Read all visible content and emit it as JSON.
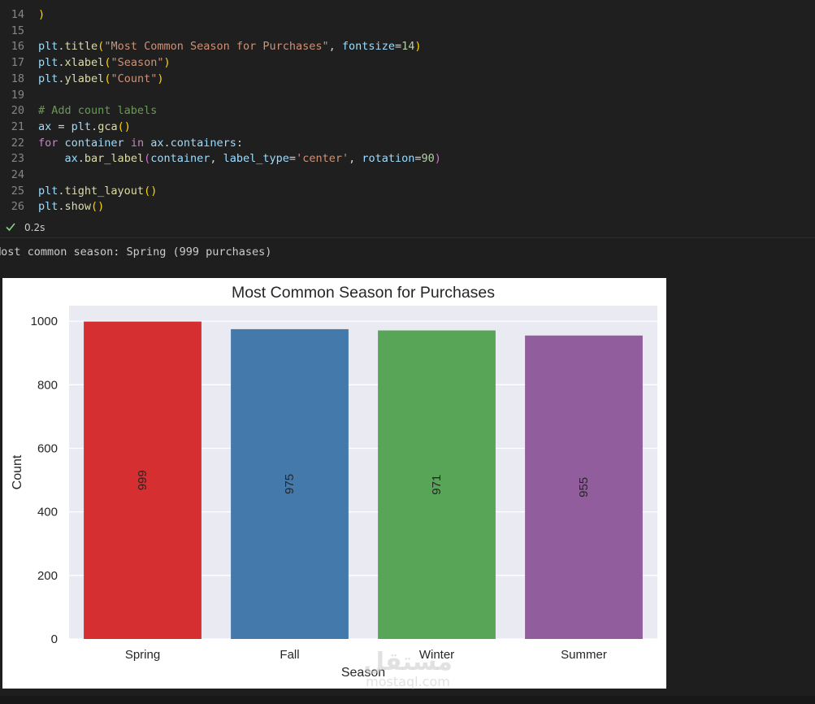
{
  "code_lines": [
    {
      "n": "14",
      "tokens": [
        {
          "t": ")",
          "c": "t-paren"
        }
      ]
    },
    {
      "n": "15",
      "tokens": []
    },
    {
      "n": "16",
      "tokens": [
        {
          "t": "plt",
          "c": "t-var"
        },
        {
          "t": ".",
          "c": ""
        },
        {
          "t": "title",
          "c": "t-fn"
        },
        {
          "t": "(",
          "c": "t-paren"
        },
        {
          "t": "\"Most Common Season for Purchases\"",
          "c": "t-str"
        },
        {
          "t": ", ",
          "c": ""
        },
        {
          "t": "fontsize",
          "c": "t-var"
        },
        {
          "t": "=",
          "c": ""
        },
        {
          "t": "14",
          "c": "t-num"
        },
        {
          "t": ")",
          "c": "t-paren"
        }
      ]
    },
    {
      "n": "17",
      "tokens": [
        {
          "t": "plt",
          "c": "t-var"
        },
        {
          "t": ".",
          "c": ""
        },
        {
          "t": "xlabel",
          "c": "t-fn"
        },
        {
          "t": "(",
          "c": "t-paren"
        },
        {
          "t": "\"Season\"",
          "c": "t-str"
        },
        {
          "t": ")",
          "c": "t-paren"
        }
      ]
    },
    {
      "n": "18",
      "tokens": [
        {
          "t": "plt",
          "c": "t-var"
        },
        {
          "t": ".",
          "c": ""
        },
        {
          "t": "ylabel",
          "c": "t-fn"
        },
        {
          "t": "(",
          "c": "t-paren"
        },
        {
          "t": "\"Count\"",
          "c": "t-str"
        },
        {
          "t": ")",
          "c": "t-paren"
        }
      ]
    },
    {
      "n": "19",
      "tokens": []
    },
    {
      "n": "20",
      "tokens": [
        {
          "t": "# Add count labels",
          "c": "t-com"
        }
      ]
    },
    {
      "n": "21",
      "tokens": [
        {
          "t": "ax",
          "c": "t-var"
        },
        {
          "t": " = ",
          "c": ""
        },
        {
          "t": "plt",
          "c": "t-var"
        },
        {
          "t": ".",
          "c": ""
        },
        {
          "t": "gca",
          "c": "t-fn"
        },
        {
          "t": "()",
          "c": "t-paren"
        }
      ]
    },
    {
      "n": "22",
      "tokens": [
        {
          "t": "for",
          "c": "t-kw"
        },
        {
          "t": " ",
          "c": ""
        },
        {
          "t": "container",
          "c": "t-var"
        },
        {
          "t": " ",
          "c": ""
        },
        {
          "t": "in",
          "c": "t-kw"
        },
        {
          "t": " ",
          "c": ""
        },
        {
          "t": "ax",
          "c": "t-var"
        },
        {
          "t": ".",
          "c": ""
        },
        {
          "t": "containers",
          "c": "t-var"
        },
        {
          "t": ":",
          "c": ""
        }
      ]
    },
    {
      "n": "23",
      "tokens": [
        {
          "t": "    ",
          "c": ""
        },
        {
          "t": "ax",
          "c": "t-var"
        },
        {
          "t": ".",
          "c": ""
        },
        {
          "t": "bar_label",
          "c": "t-fn"
        },
        {
          "t": "(",
          "c": "t-paren2"
        },
        {
          "t": "container",
          "c": "t-var"
        },
        {
          "t": ", ",
          "c": ""
        },
        {
          "t": "label_type",
          "c": "t-var"
        },
        {
          "t": "=",
          "c": ""
        },
        {
          "t": "'center'",
          "c": "t-str"
        },
        {
          "t": ", ",
          "c": ""
        },
        {
          "t": "rotation",
          "c": "t-var"
        },
        {
          "t": "=",
          "c": ""
        },
        {
          "t": "90",
          "c": "t-num"
        },
        {
          "t": ")",
          "c": "t-paren2"
        }
      ]
    },
    {
      "n": "24",
      "tokens": []
    },
    {
      "n": "25",
      "tokens": [
        {
          "t": "plt",
          "c": "t-var"
        },
        {
          "t": ".",
          "c": ""
        },
        {
          "t": "tight_layout",
          "c": "t-fn"
        },
        {
          "t": "()",
          "c": "t-paren"
        }
      ]
    },
    {
      "n": "26",
      "tokens": [
        {
          "t": "plt",
          "c": "t-var"
        },
        {
          "t": ".",
          "c": ""
        },
        {
          "t": "show",
          "c": "t-fn"
        },
        {
          "t": "()",
          "c": "t-paren"
        }
      ]
    }
  ],
  "cell_status": {
    "icon": "check-icon",
    "time": "0.2s",
    "color": "#89d185"
  },
  "output": {
    "text": "Most common season: Spring (999 purchases)"
  },
  "chart_data": {
    "type": "bar",
    "title": "Most Common Season for Purchases",
    "xlabel": "Season",
    "ylabel": "Count",
    "categories": [
      "Spring",
      "Fall",
      "Winter",
      "Summer"
    ],
    "values": [
      999,
      975,
      971,
      955
    ],
    "colors": [
      "#d62f31",
      "#447aab",
      "#58a558",
      "#925d9d"
    ],
    "value_labels": [
      "999",
      "975",
      "971",
      "955"
    ],
    "yticks": [
      "0",
      "200",
      "400",
      "600",
      "800",
      "1000"
    ],
    "ylim": [
      0,
      1049
    ],
    "grid": true,
    "background": "#eaeaf2",
    "value_label_rotation": 90,
    "value_label_position": "center"
  },
  "watermark": {
    "text": "mostaql.com"
  }
}
